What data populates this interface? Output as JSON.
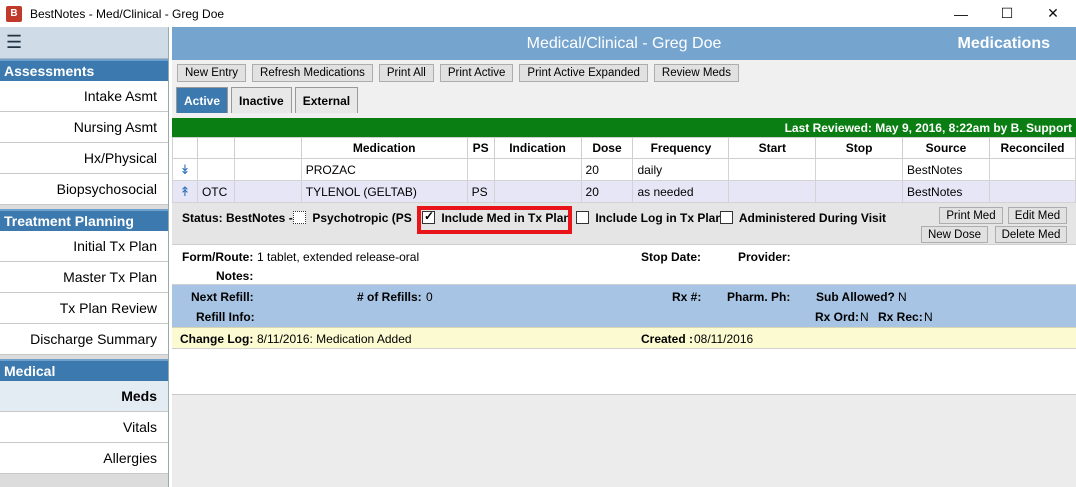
{
  "window": {
    "title": "BestNotes - Med/Clinical - Greg Doe",
    "minimize": "—",
    "maximize": "☐",
    "close": "✕"
  },
  "sidebar": {
    "sections": [
      {
        "title": "Assessments",
        "items": [
          "Intake Asmt",
          "Nursing Asmt",
          "Hx/Physical",
          "Biopsychosocial"
        ]
      },
      {
        "title": "Treatment Planning",
        "items": [
          "Initial Tx Plan",
          "Master Tx Plan",
          "Tx Plan Review",
          "Discharge Summary"
        ]
      },
      {
        "title": "Medical",
        "items": [
          "Meds",
          "Vitals",
          "Allergies"
        ]
      }
    ]
  },
  "header": {
    "title": "Medical/Clinical - Greg Doe",
    "section": "Medications"
  },
  "toolbar": {
    "buttons": [
      "New Entry",
      "Refresh Medications",
      "Print All",
      "Print Active",
      "Print Active Expanded",
      "Review Meds"
    ]
  },
  "tabs": [
    "Active",
    "Inactive",
    "External"
  ],
  "last_reviewed": "Last Reviewed: May 9, 2016, 8:22am by B. Support",
  "table": {
    "columns": [
      "Medication",
      "PS",
      "Indication",
      "Dose",
      "Frequency",
      "Start",
      "Stop",
      "Source",
      "Reconciled"
    ],
    "rows": [
      {
        "otc": "",
        "medication": "PROZAC",
        "ps": "",
        "indication": "",
        "dose": "20",
        "frequency": "daily",
        "start": "",
        "stop": "",
        "source": "BestNotes",
        "reconciled": ""
      },
      {
        "otc": "OTC",
        "medication": "TYLENOL (GELTAB)",
        "ps": "PS",
        "indication": "",
        "dose": "20",
        "frequency": "as needed",
        "start": "",
        "stop": "",
        "source": "BestNotes",
        "reconciled": ""
      }
    ]
  },
  "detail": {
    "status_label": "Status: BestNotes -",
    "psychotropic_label": "Psychotropic (PS",
    "include_med_label": "Include Med in Tx Plan",
    "include_log_label": "Include Log in Tx Plan",
    "administered_label": "Administered During Visit",
    "buttons": {
      "print_med": "Print Med",
      "edit_med": "Edit Med",
      "new_dose": "New Dose",
      "delete_med": "Delete Med"
    },
    "form_route_label": "Form/Route:",
    "form_route_value": "1 tablet, extended release-oral",
    "stop_date_label": "Stop Date:",
    "provider_label": "Provider:",
    "notes_label": "Notes:",
    "next_refill_label": "Next Refill:",
    "num_refills_label": "# of Refills:",
    "num_refills_value": "0",
    "rx_label": "Rx #:",
    "pharm_label": "Pharm. Ph:",
    "sub_allowed_label": "Sub Allowed?",
    "sub_allowed_value": "N",
    "refill_info_label": "Refill Info:",
    "rx_ord_label": "Rx Ord:",
    "rx_ord_value": "N",
    "rx_rec_label": "Rx Rec:",
    "rx_rec_value": "N",
    "change_log_label": "Change Log:",
    "change_log_value": "8/11/2016: Medication Added",
    "created_label": "Created :",
    "created_value": "08/11/2016"
  }
}
